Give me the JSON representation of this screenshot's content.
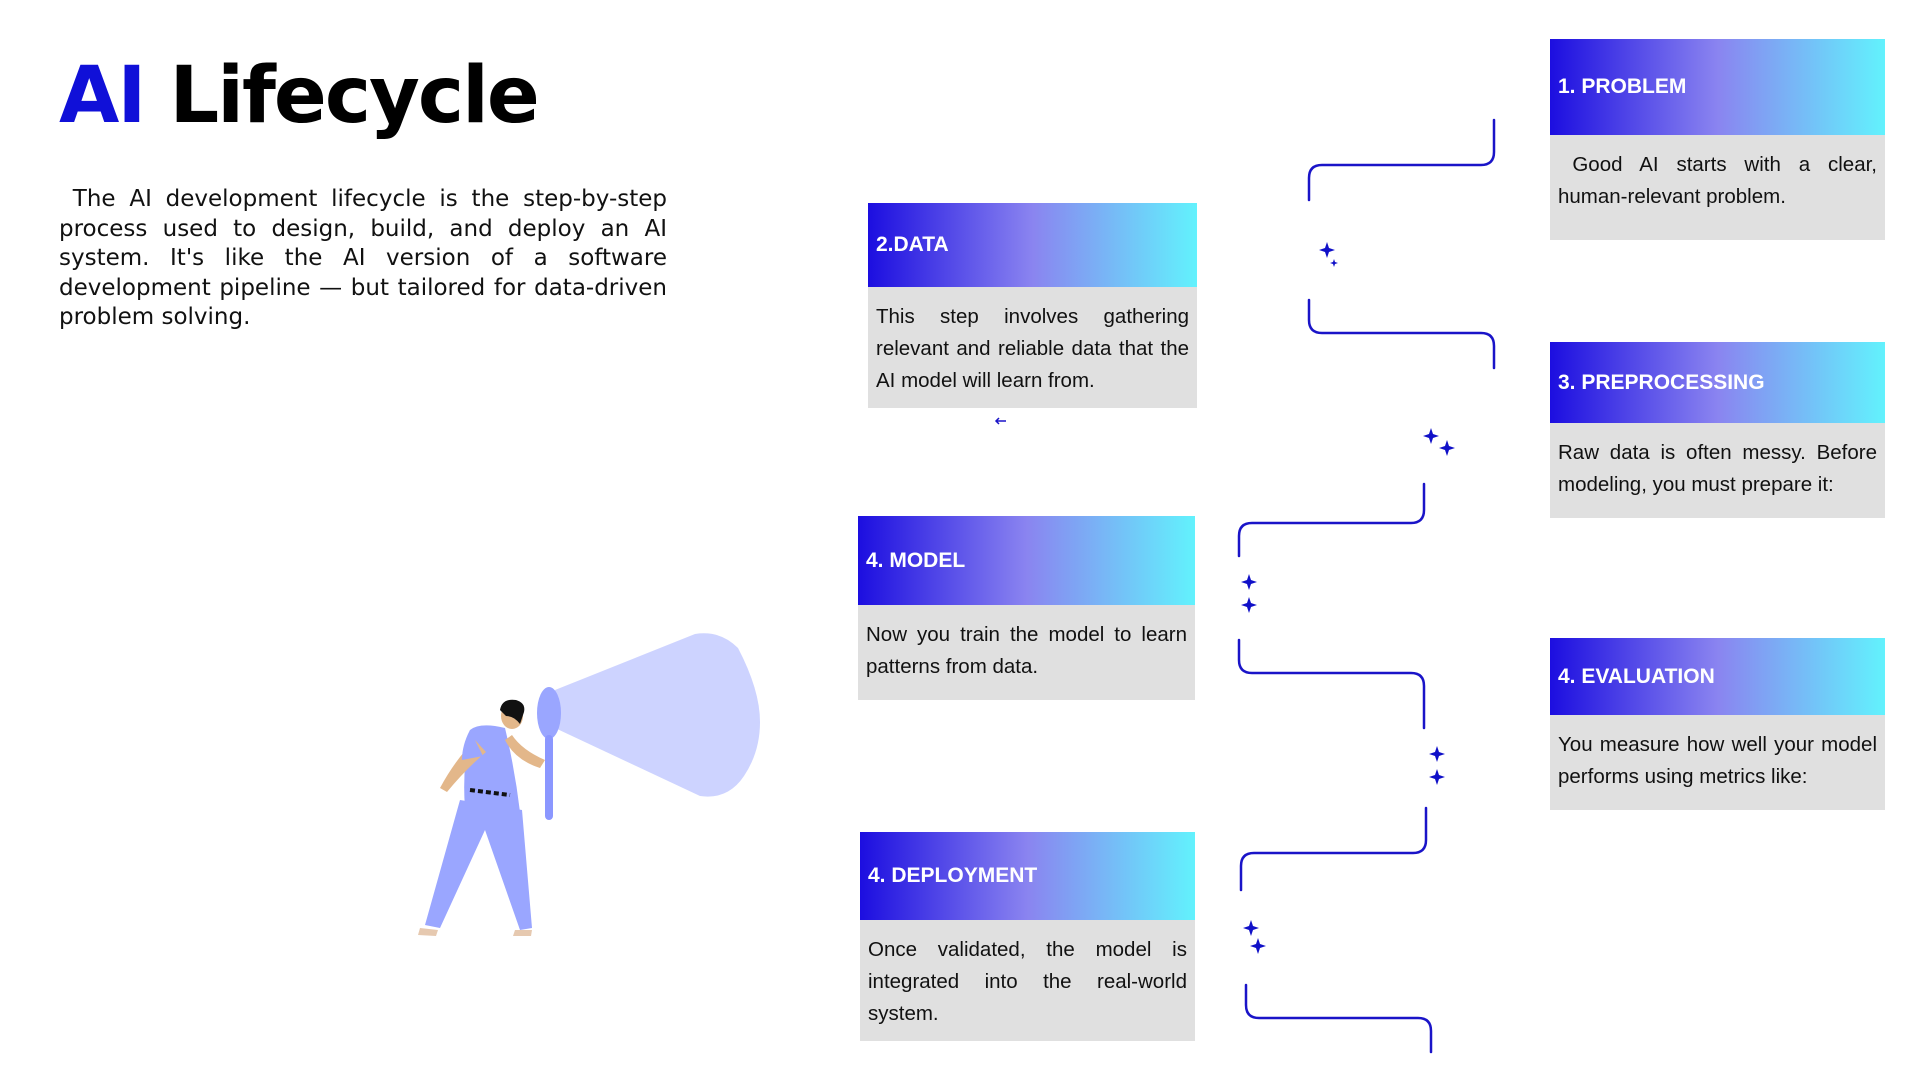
{
  "header": {
    "title_accent": "AI",
    "title_rest": "Lifecycle"
  },
  "intro": "The AI development lifecycle is the step-by-step process used to design, build, and deploy an AI system. It's like the AI version of a software development pipeline — but tailored for data-driven problem solving.",
  "steps": [
    {
      "title": "1. PROBLEM",
      "text": "Good AI starts with a clear, human-relevant problem."
    },
    {
      "title": "2.DATA",
      "text": "This step involves gathering relevant and reliable data that the AI model will learn from."
    },
    {
      "title": "3. PREPROCESSING",
      "text": "Raw data is often messy. Before modeling, you must prepare it:"
    },
    {
      "title": "4. MODEL",
      "text": "Now you train the model to learn patterns from data."
    },
    {
      "title": "4. EVALUATION",
      "text": "You measure how well your model performs using metrics like:"
    },
    {
      "title": "4. DEPLOYMENT",
      "text": "Once validated, the model is integrated into the real-world system."
    }
  ],
  "colors": {
    "accent": "#1010d8",
    "gradient_start": "#1c0ee0",
    "gradient_mid": "#8a84f0",
    "gradient_end": "#62f2fd",
    "card_body": "#e0e0e0",
    "connector": "#1a14c8",
    "illustration": "#9aa6ff"
  },
  "icons": [
    "sparkle-icon",
    "person-with-megaphone-illustration"
  ]
}
